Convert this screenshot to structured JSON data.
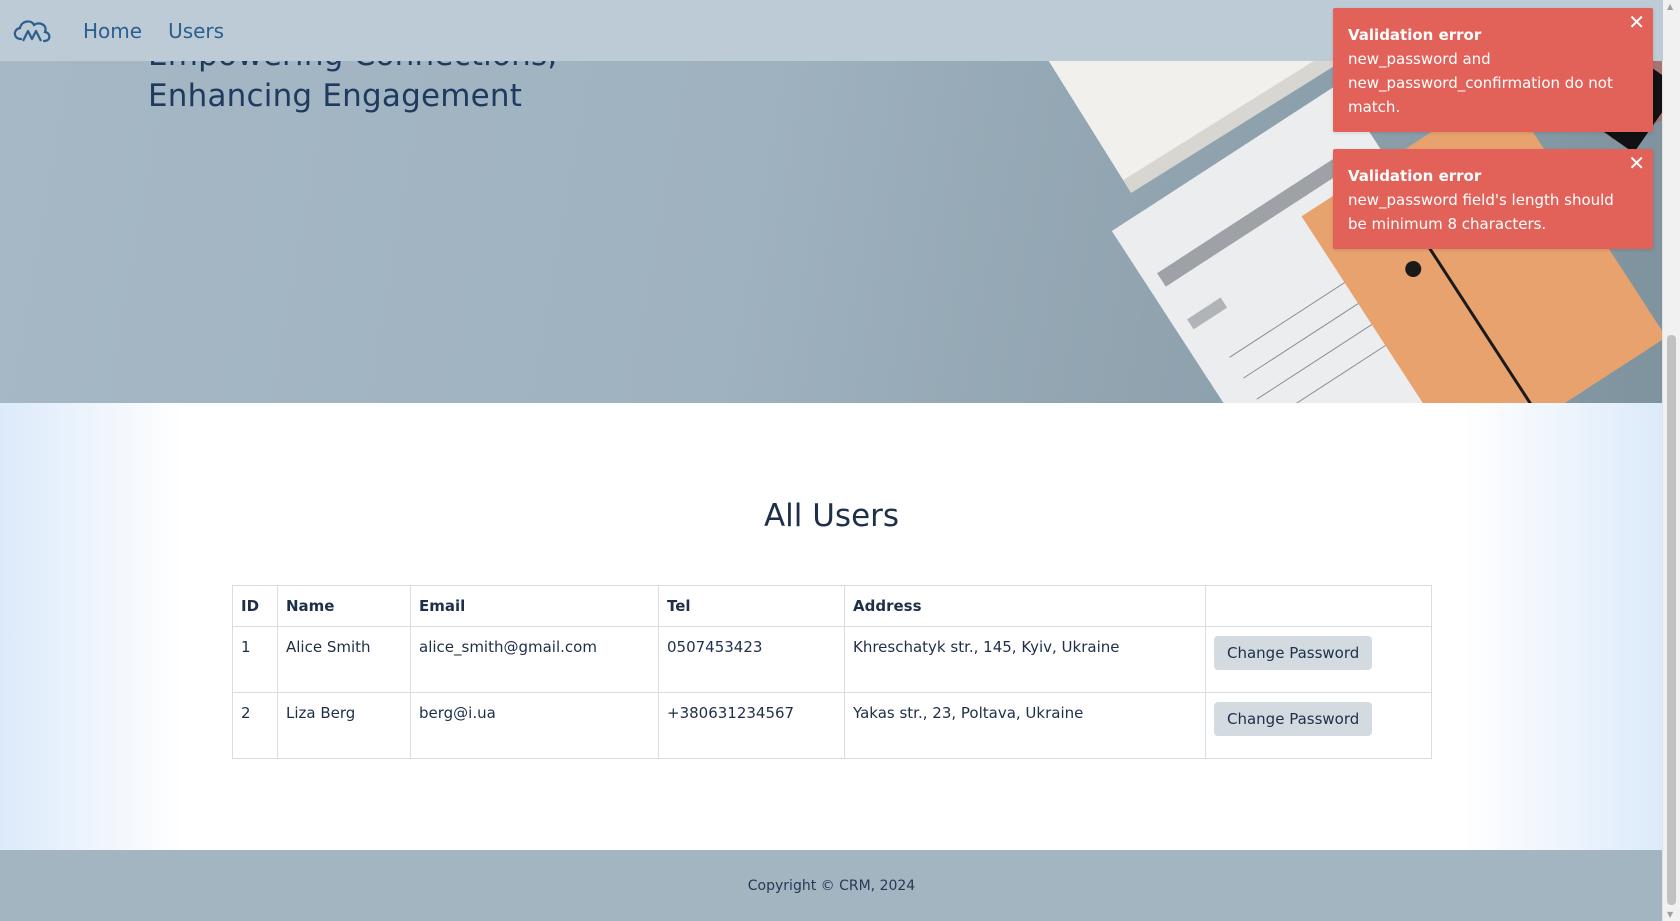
{
  "nav": {
    "links": [
      {
        "label": "Home"
      },
      {
        "label": "Users"
      }
    ]
  },
  "hero": {
    "headline_line1": "Empowering Connections,",
    "headline_line2": "Enhancing Engagement"
  },
  "main": {
    "title": "All Users",
    "table": {
      "headers": [
        "ID",
        "Name",
        "Email",
        "Tel",
        "Address",
        ""
      ],
      "rows": [
        {
          "id": "1",
          "name": "Alice Smith",
          "email": "alice_smith@gmail.com",
          "tel": "0507453423",
          "address": "Khreschatyk str., 145, Kyiv, Ukraine",
          "action": "Change Password"
        },
        {
          "id": "2",
          "name": "Liza Berg",
          "email": "berg@i.ua",
          "tel": "+380631234567",
          "address": "Yakas str., 23, Poltava, Ukraine",
          "action": "Change Password"
        }
      ]
    }
  },
  "toasts": [
    {
      "title": "Validation error",
      "message": "new_password and new_password_confirmation do not match.",
      "close": "✕"
    },
    {
      "title": "Validation error",
      "message": "new_password field's length should be minimum 8 characters.",
      "close": "✕"
    }
  ],
  "footer": {
    "text": "Copyright © CRM, 2024"
  },
  "colors": {
    "navbar": "#bccbd5",
    "hero": "#a6b8c6",
    "toast_error": "#e2625a",
    "footer": "#a3b5c1",
    "button": "#d3dbe1"
  },
  "icons": [
    "logo-icon",
    "close-icon"
  ]
}
